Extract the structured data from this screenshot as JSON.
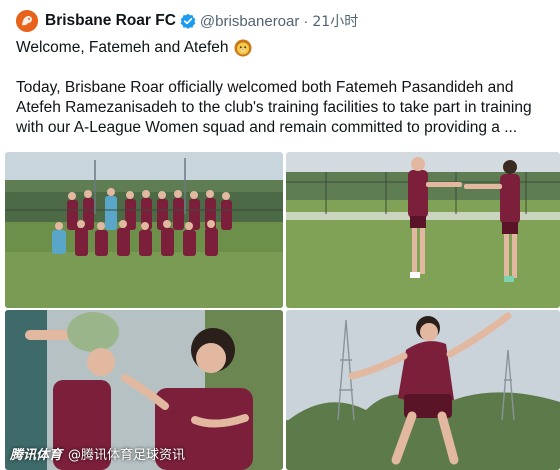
{
  "account": {
    "name": "Brisbane Roar FC",
    "handle": "@brisbaneroar",
    "separator": "·",
    "time": "21小时",
    "avatar_icon": "brisbane-roar-lion-logo",
    "avatar_color": "#e8621b",
    "verified_icon": "verified-badge",
    "verified_color": "#1d9bf0"
  },
  "post": {
    "headline": "Welcome, Fatemeh and Atefeh",
    "headline_emoji": "lion-face-emoji",
    "body": "Today, Brisbane Roar officially welcomed both Fatemeh Pasandideh and Atefeh Ramezanisadeh to the club's training facilities to take part in training with our A-League Women squad and remain committed to providing a ..."
  },
  "media": {
    "photos": [
      {
        "name": "team-group-photo"
      },
      {
        "name": "players-handshake-photo"
      },
      {
        "name": "player-smiling-photo"
      },
      {
        "name": "player-kicking-photo"
      }
    ],
    "jersey_color": "#7b1f3a"
  },
  "watermark": {
    "brand": "腾讯体育",
    "handle": "@腾讯体育足球资讯"
  }
}
